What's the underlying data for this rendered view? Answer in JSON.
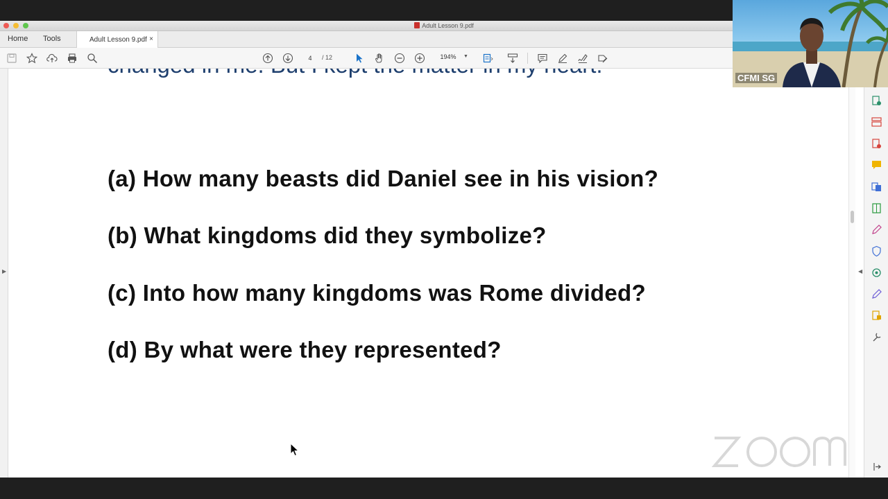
{
  "window": {
    "title": "Adult Lesson 9.pdf"
  },
  "tabs": {
    "home": "Home",
    "tools": "Tools",
    "document": "Adult Lesson 9.pdf",
    "close": "×"
  },
  "toolbar": {
    "page_current": "4",
    "page_total": "/ 12",
    "zoom": "194%"
  },
  "document": {
    "partial_line": "changed in me. But I kept the matter in my heart.",
    "questions": [
      "(a) How many beasts did Daniel see in his vision?",
      "(b) What kingdoms did they symbolize?",
      "(c) Into how many kingdoms was Rome divided?",
      "(d) By what were they represented?"
    ]
  },
  "video": {
    "participant_name": "CFMI SG"
  },
  "colors": {
    "doc_text": "#111111",
    "partial_line_text": "#1e3f6e",
    "accent_blue": "#1a73c9"
  }
}
